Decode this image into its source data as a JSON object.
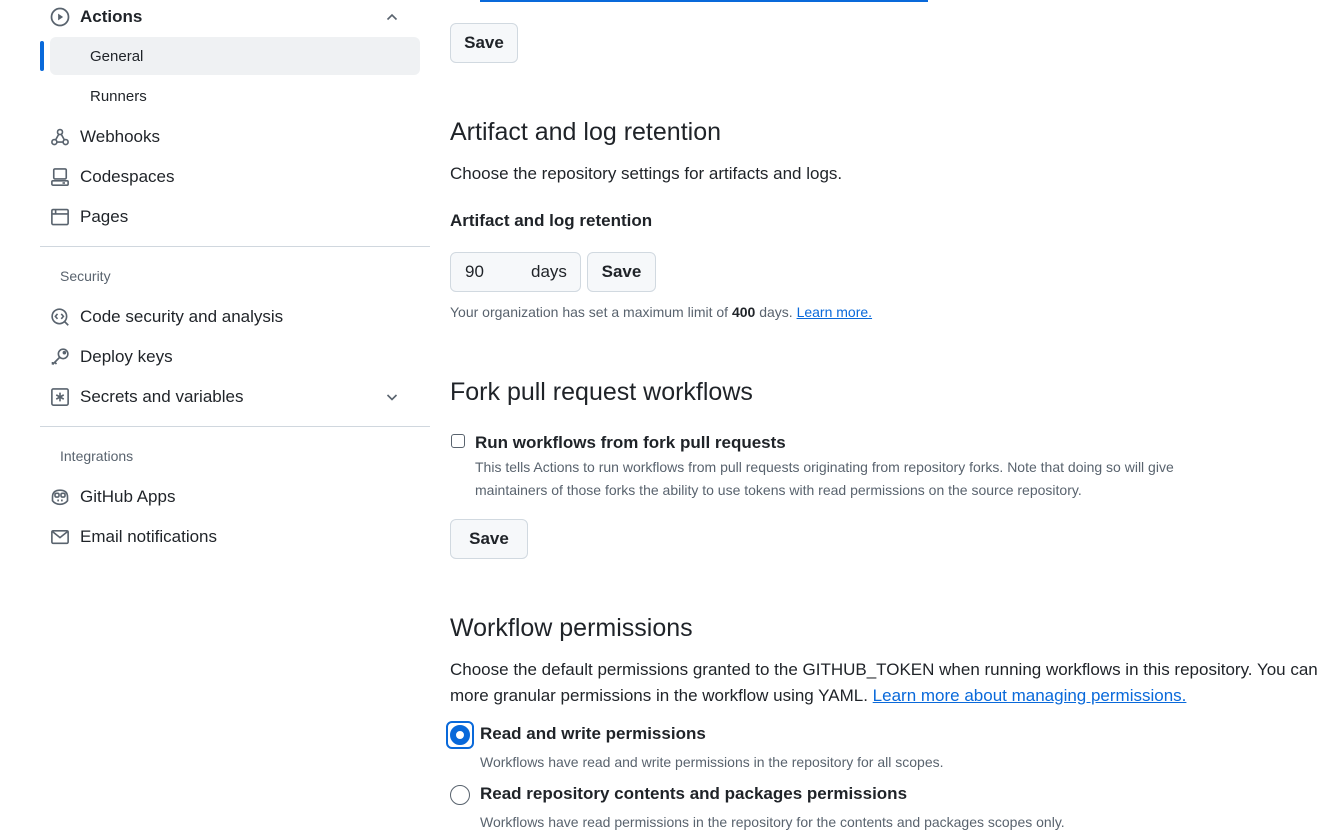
{
  "sidebar": {
    "actions_label": "Actions",
    "actions_sub": [
      {
        "label": "General",
        "active": true
      },
      {
        "label": "Runners",
        "active": false
      }
    ],
    "items": [
      {
        "label": "Webhooks",
        "icon": "webhook-icon"
      },
      {
        "label": "Codespaces",
        "icon": "codespaces-icon"
      },
      {
        "label": "Pages",
        "icon": "browser-icon"
      }
    ],
    "security_heading": "Security",
    "security_items": [
      {
        "label": "Code security and analysis",
        "icon": "codescan-icon"
      },
      {
        "label": "Deploy keys",
        "icon": "key-icon"
      },
      {
        "label": "Secrets and variables",
        "icon": "asterisk-icon"
      }
    ],
    "integrations_heading": "Integrations",
    "integrations_items": [
      {
        "label": "GitHub Apps",
        "icon": "copilot-icon"
      },
      {
        "label": "Email notifications",
        "icon": "mail-icon"
      }
    ]
  },
  "main": {
    "save_label": "Save",
    "artifact": {
      "title": "Artifact and log retention",
      "description": "Choose the repository settings for artifacts and logs.",
      "field_label": "Artifact and log retention",
      "value": "90",
      "unit": "days",
      "note_prefix": "Your organization has set a maximum limit of",
      "note_limit": "400",
      "note_suffix": "days.",
      "note_link": "Learn more."
    },
    "fork": {
      "title": "Fork pull request workflows",
      "checkbox_label": "Run workflows from fork pull requests",
      "checked": false,
      "help_line1": "This tells Actions to run workflows from pull requests originating from repository forks. Note that doing so will give",
      "help_line2": "maintainers of those forks the ability to use tokens with read permissions on the source repository."
    },
    "workflow": {
      "title": "Workflow permissions",
      "desc_line1": "Choose the default permissions granted to the GITHUB_TOKEN when running workflows in this repository. You can",
      "desc_line2": "more granular permissions in the workflow using YAML.",
      "desc_link": "Learn more about managing permissions.",
      "options": [
        {
          "label": "Read and write permissions",
          "help": "Workflows have read and write permissions in the repository for all scopes.",
          "checked": true
        },
        {
          "label": "Read repository contents and packages permissions",
          "help": "Workflows have read permissions in the repository for the contents and packages scopes only.",
          "checked": false
        }
      ]
    }
  },
  "colors": {
    "accent": "#0969da",
    "muted": "#59636e",
    "border": "#d1d9e0",
    "active_bg": "#eff1f3"
  }
}
